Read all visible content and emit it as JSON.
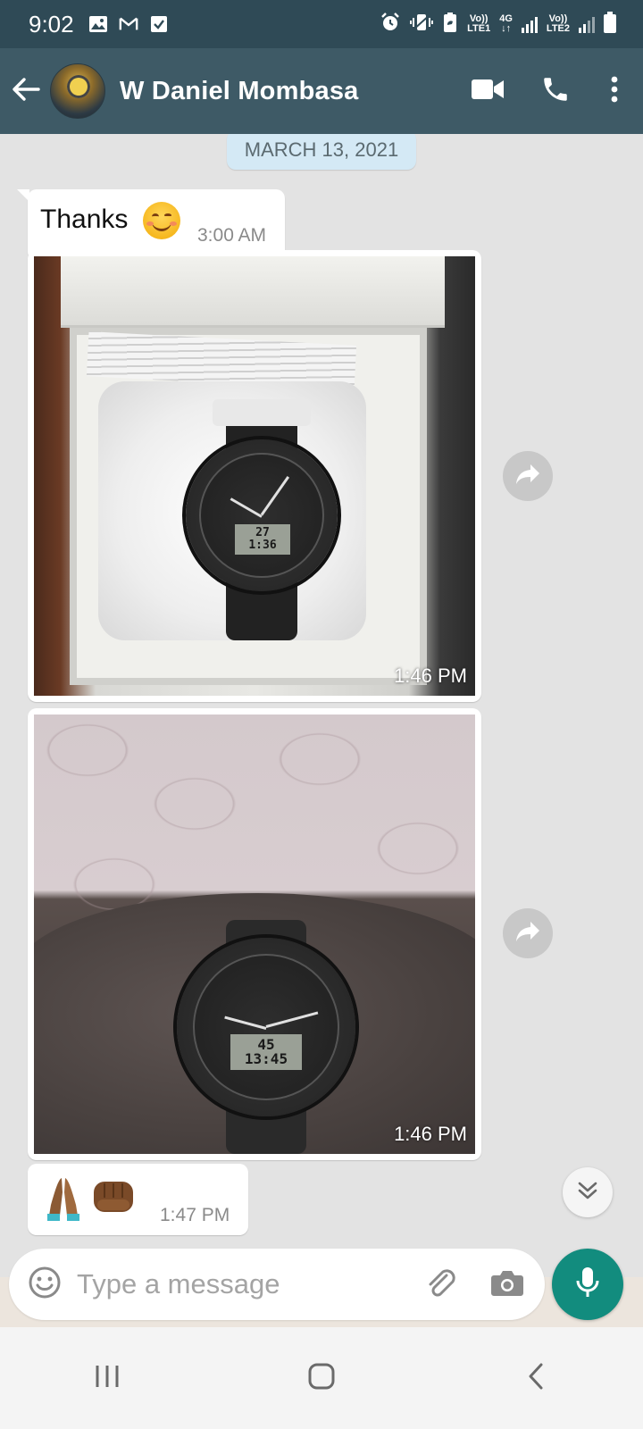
{
  "status_bar": {
    "time": "9:02",
    "icons": [
      "image-icon",
      "gmail-icon",
      "checkbox-icon",
      "alarm-icon",
      "vibrate-icon",
      "battery-saver-icon",
      "volte-lte1-icon",
      "4g-icon",
      "signal-1-icon",
      "volte-lte2-icon",
      "signal-2-icon",
      "battery-icon"
    ],
    "sim1_label_top": "Vo))",
    "sim1_label_bottom": "LTE1",
    "network_label_top": "4G",
    "network_label_bottom": "↓↑",
    "sim2_label_top": "Vo))",
    "sim2_label_bottom": "LTE2"
  },
  "header": {
    "contact_name": "W Daniel Mombasa",
    "actions": [
      "video-call-icon",
      "voice-call-icon",
      "more-options-icon"
    ]
  },
  "chat": {
    "date_chip": "MARCH 13, 2021",
    "messages": [
      {
        "type": "text",
        "text": "Thanks",
        "emoji": "smiling-face",
        "time": "3:00 AM"
      },
      {
        "type": "image",
        "description": "watch-in-box",
        "lcd_top": "27",
        "lcd_bottom": "1:36",
        "time": "1:46 PM"
      },
      {
        "type": "image",
        "description": "watch-on-wrist",
        "lcd_top": "45",
        "lcd_bottom": "13:45",
        "time": "1:46 PM"
      },
      {
        "type": "emoji",
        "emojis": [
          "folded-hands",
          "oncoming-fist"
        ],
        "time": "1:47 PM"
      }
    ]
  },
  "input": {
    "placeholder": "Type a message",
    "value": ""
  },
  "colors": {
    "status_bar": "#2f4a56",
    "header": "#3e5a66",
    "chat_bg": "#e3e3e3",
    "date_chip": "#d4e9f5",
    "mic_button": "#128c7e"
  }
}
